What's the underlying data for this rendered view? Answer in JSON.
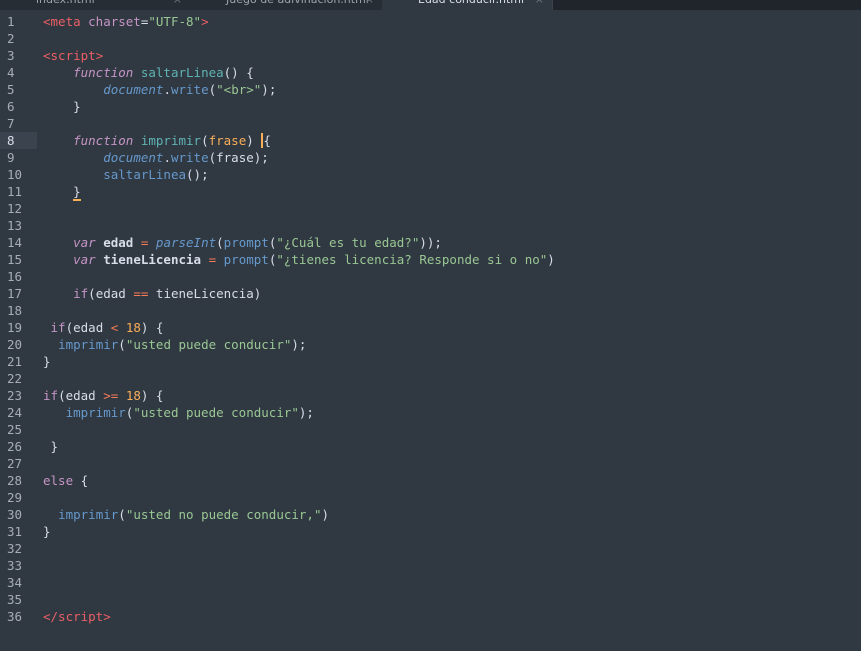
{
  "tabs": [
    {
      "label": "index.html",
      "close": "×",
      "active": false
    },
    {
      "label": "Juego de adivinación.html",
      "close": "×",
      "active": false
    },
    {
      "label": "Edad conducir.html",
      "close": "×",
      "active": true
    }
  ],
  "editor": {
    "current_line": 8,
    "lines": [
      [
        [
          "t-tag",
          "<meta "
        ],
        [
          "t-attr",
          "charset"
        ],
        [
          "t-punc",
          "="
        ],
        [
          "t-str",
          "\"UTF-8\""
        ],
        [
          "t-tag",
          ">"
        ]
      ],
      [],
      [
        [
          "t-tag",
          "<script"
        ],
        [
          "t-tag",
          ">"
        ]
      ],
      [
        [
          "t-punc",
          "    "
        ],
        [
          "t-kw",
          "function"
        ],
        [
          "t-punc",
          " "
        ],
        [
          "t-fn",
          "saltarLinea"
        ],
        [
          "t-punc",
          "() {"
        ]
      ],
      [
        [
          "t-punc",
          "        "
        ],
        [
          "t-obj",
          "document"
        ],
        [
          "t-punc",
          "."
        ],
        [
          "t-fn2",
          "write"
        ],
        [
          "t-punc",
          "("
        ],
        [
          "t-str",
          "\"<br>\""
        ],
        [
          "t-punc",
          ");"
        ]
      ],
      [
        [
          "t-punc",
          "    }"
        ]
      ],
      [],
      [
        [
          "t-punc",
          "    "
        ],
        [
          "t-kw",
          "function"
        ],
        [
          "t-punc",
          " "
        ],
        [
          "t-fn",
          "imprimir"
        ],
        [
          "t-punc",
          "("
        ],
        [
          "t-param",
          "frase"
        ],
        [
          "t-punc",
          ") "
        ],
        [
          "caret",
          "{"
        ]
      ],
      [
        [
          "t-punc",
          "        "
        ],
        [
          "t-obj",
          "document"
        ],
        [
          "t-punc",
          "."
        ],
        [
          "t-fn2",
          "write"
        ],
        [
          "t-punc",
          "(frase);"
        ]
      ],
      [
        [
          "t-punc",
          "        "
        ],
        [
          "t-fn2",
          "saltarLinea"
        ],
        [
          "t-punc",
          "();"
        ]
      ],
      [
        [
          "t-punc",
          "    "
        ],
        [
          "mark",
          "}"
        ]
      ],
      [],
      [],
      [
        [
          "t-punc",
          "    "
        ],
        [
          "t-kw",
          "var"
        ],
        [
          "t-punc",
          " "
        ],
        [
          "t-var",
          "edad"
        ],
        [
          "t-punc",
          " "
        ],
        [
          "t-op",
          "="
        ],
        [
          "t-punc",
          " "
        ],
        [
          "t-obj",
          "parseInt"
        ],
        [
          "t-punc",
          "("
        ],
        [
          "t-fn2",
          "prompt"
        ],
        [
          "t-punc",
          "("
        ],
        [
          "t-str",
          "\"¿Cuál es tu edad?\""
        ],
        [
          "t-punc",
          "));"
        ]
      ],
      [
        [
          "t-punc",
          "    "
        ],
        [
          "t-kw",
          "var"
        ],
        [
          "t-punc",
          " "
        ],
        [
          "t-var",
          "tieneLicencia"
        ],
        [
          "t-punc",
          " "
        ],
        [
          "t-op",
          "="
        ],
        [
          "t-punc",
          " "
        ],
        [
          "t-fn2",
          "prompt"
        ],
        [
          "t-punc",
          "("
        ],
        [
          "t-str",
          "\"¿tienes licencia? Responde si o no\""
        ],
        [
          "t-punc",
          ")"
        ]
      ],
      [],
      [
        [
          "t-punc",
          "    "
        ],
        [
          "t-ctl",
          "if"
        ],
        [
          "t-punc",
          "(edad "
        ],
        [
          "t-op",
          "=="
        ],
        [
          "t-punc",
          " tieneLicencia)"
        ]
      ],
      [],
      [
        [
          "t-punc",
          " "
        ],
        [
          "t-ctl",
          "if"
        ],
        [
          "t-punc",
          "(edad "
        ],
        [
          "t-op",
          "<"
        ],
        [
          "t-punc",
          " "
        ],
        [
          "t-num",
          "18"
        ],
        [
          "t-punc",
          ") {"
        ]
      ],
      [
        [
          "t-punc",
          "  "
        ],
        [
          "t-fn2",
          "imprimir"
        ],
        [
          "t-punc",
          "("
        ],
        [
          "t-str",
          "\"usted puede conducir\""
        ],
        [
          "t-punc",
          ");"
        ]
      ],
      [
        [
          "t-punc",
          "}"
        ]
      ],
      [],
      [
        [
          "t-ctl",
          "if"
        ],
        [
          "t-punc",
          "(edad "
        ],
        [
          "t-op",
          ">="
        ],
        [
          "t-punc",
          " "
        ],
        [
          "t-num",
          "18"
        ],
        [
          "t-punc",
          ") {"
        ]
      ],
      [
        [
          "t-punc",
          "   "
        ],
        [
          "t-fn2",
          "imprimir"
        ],
        [
          "t-punc",
          "("
        ],
        [
          "t-str",
          "\"usted puede conducir\""
        ],
        [
          "t-punc",
          ");"
        ]
      ],
      [],
      [
        [
          "t-punc",
          " }"
        ]
      ],
      [],
      [
        [
          "t-ctl",
          "else"
        ],
        [
          "t-punc",
          " {"
        ]
      ],
      [],
      [
        [
          "t-punc",
          "  "
        ],
        [
          "t-fn2",
          "imprimir"
        ],
        [
          "t-punc",
          "("
        ],
        [
          "t-str",
          "\"usted no puede conducir,\""
        ],
        [
          "t-punc",
          ")"
        ]
      ],
      [
        [
          "t-punc",
          "}"
        ]
      ],
      [],
      [],
      [],
      [],
      [
        [
          "t-tag",
          "</script"
        ],
        [
          "t-tag",
          ">"
        ]
      ]
    ]
  }
}
